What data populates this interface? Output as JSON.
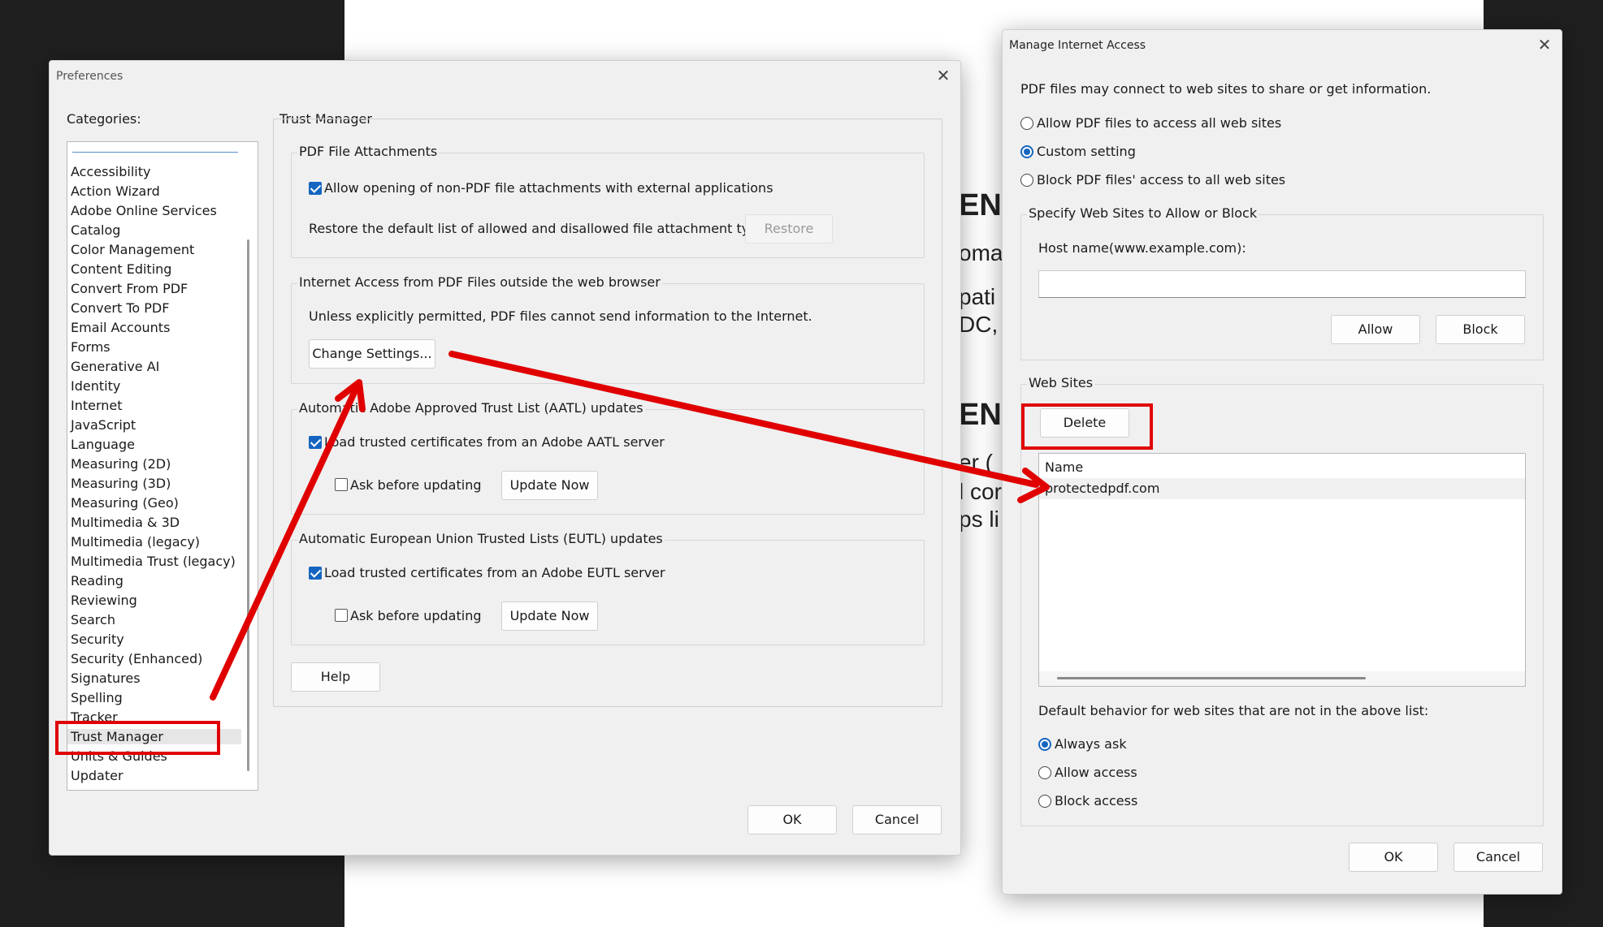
{
  "background_doc": {
    "lines": [
      "EN",
      "oma",
      "pati",
      "DC,",
      "EN",
      "er (",
      "l cor",
      "ps li"
    ]
  },
  "preferences": {
    "title": "Preferences",
    "categories_label": "Categories:",
    "categories": [
      "Accessibility",
      "Action Wizard",
      "Adobe Online Services",
      "Catalog",
      "Color Management",
      "Content Editing",
      "Convert From PDF",
      "Convert To PDF",
      "Email Accounts",
      "Forms",
      "Generative AI",
      "Identity",
      "Internet",
      "JavaScript",
      "Language",
      "Measuring (2D)",
      "Measuring (3D)",
      "Measuring (Geo)",
      "Multimedia & 3D",
      "Multimedia (legacy)",
      "Multimedia Trust (legacy)",
      "Reading",
      "Reviewing",
      "Search",
      "Security",
      "Security (Enhanced)",
      "Signatures",
      "Spelling",
      "Tracker",
      "Trust Manager",
      "Units & Guides",
      "Updater"
    ],
    "selected_category": "Trust Manager",
    "panel_title": "Trust Manager",
    "attachments": {
      "title": "PDF File Attachments",
      "allow_label": "Allow opening of non-PDF file attachments with external applications",
      "allow_checked": true,
      "restore_text": "Restore the default list of allowed and disallowed file attachment types:",
      "restore_button": "Restore"
    },
    "internet": {
      "title": "Internet Access from PDF Files outside the web browser",
      "text": "Unless explicitly permitted, PDF files cannot send information to the Internet.",
      "change_button": "Change Settings..."
    },
    "aatl": {
      "title": "Automatic Adobe Approved Trust List (AATL) updates",
      "load_label": "Load trusted certificates from an Adobe AATL server",
      "load_checked": true,
      "ask_label": "Ask before updating",
      "ask_checked": false,
      "update_button": "Update Now"
    },
    "eutl": {
      "title": "Automatic European Union Trusted Lists (EUTL) updates",
      "load_label": "Load trusted certificates from an Adobe EUTL server",
      "load_checked": true,
      "ask_label": "Ask before updating",
      "ask_checked": false,
      "update_button": "Update Now"
    },
    "help_button": "Help",
    "ok_button": "OK",
    "cancel_button": "Cancel"
  },
  "manage": {
    "title": "Manage Internet Access",
    "intro": "PDF files may connect to web sites to share or get information.",
    "options": [
      {
        "label": "Allow PDF files to access all web sites",
        "selected": false
      },
      {
        "label": "Custom setting",
        "selected": true
      },
      {
        "label": "Block PDF files' access to all web sites",
        "selected": false
      }
    ],
    "specify_title": "Specify Web Sites to Allow or Block",
    "host_label": "Host name(www.example.com):",
    "host_value": "",
    "allow_button": "Allow",
    "block_button": "Block",
    "websites_title": "Web Sites",
    "delete_button": "Delete",
    "list_header": "Name",
    "sites": [
      "protectedpdf.com"
    ],
    "default_label": "Default behavior for web sites that are not in the above list:",
    "default_options": [
      {
        "label": "Always ask",
        "selected": true
      },
      {
        "label": "Allow access",
        "selected": false
      },
      {
        "label": "Block access",
        "selected": false
      }
    ],
    "ok_button": "OK",
    "cancel_button": "Cancel"
  },
  "colors": {
    "annotation_red": "#e00000",
    "accent_blue": "#1565c0"
  }
}
